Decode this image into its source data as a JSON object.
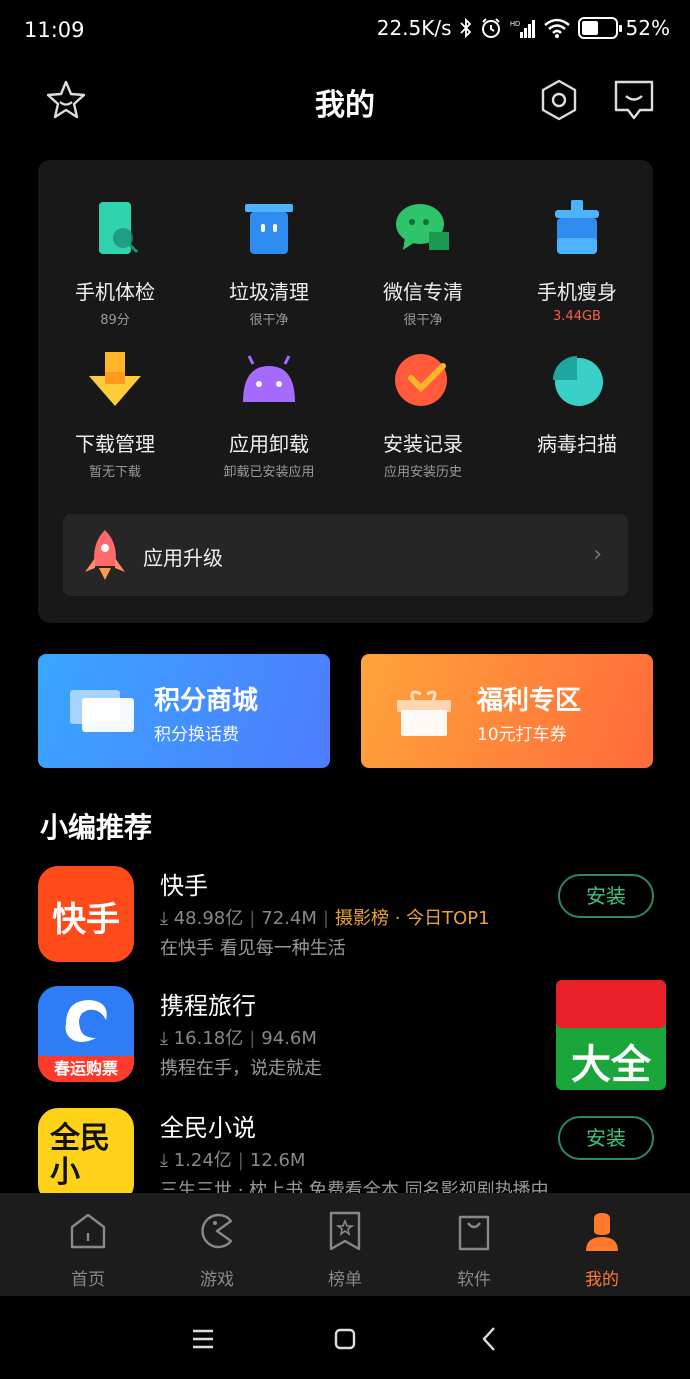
{
  "status_bar": {
    "time": "11:09",
    "speed": "22.5K/s",
    "battery": "52%",
    "battery_level": 0.52
  },
  "header": {
    "title": "我的"
  },
  "tools": [
    {
      "label": "手机体检",
      "sub": "89分"
    },
    {
      "label": "垃圾清理",
      "sub": "很干净"
    },
    {
      "label": "微信专清",
      "sub": "很干净"
    },
    {
      "label": "手机瘦身",
      "sub": "3.44GB"
    },
    {
      "label": "下载管理",
      "sub": "暂无下载"
    },
    {
      "label": "应用卸载",
      "sub": "卸载已安装应用"
    },
    {
      "label": "安装记录",
      "sub": "应用安装历史"
    },
    {
      "label": "病毒扫描",
      "sub": ""
    }
  ],
  "upgrade": {
    "label": "应用升级"
  },
  "promos": {
    "points": {
      "title": "积分商城",
      "sub": "积分换话费"
    },
    "welfare": {
      "title": "福利专区",
      "sub": "10元打车券"
    }
  },
  "recommend": {
    "title": "小编推荐",
    "apps": [
      {
        "name": "快手",
        "downloads": "48.98亿",
        "size": "72.4M",
        "tag": "摄影榜 · 今日TOP1",
        "desc": "在快手 看见每一种生活",
        "icon_text": "快手",
        "action": "安装"
      },
      {
        "name": "携程旅行",
        "downloads": "16.18亿",
        "size": "94.6M",
        "tag": "",
        "desc": "携程在手，说走就走",
        "icon_text": "春运购票",
        "ad_text": "大全"
      },
      {
        "name": "全民小说",
        "downloads": "1.24亿",
        "size": "12.6M",
        "tag": "",
        "desc": "三生三世 · 枕上书 免费看全本 同名影视剧热播中",
        "icon_text": "全民小",
        "action": "安装"
      }
    ]
  },
  "bottom_nav": [
    {
      "label": "首页",
      "icon": "home-icon"
    },
    {
      "label": "游戏",
      "icon": "game-icon"
    },
    {
      "label": "榜单",
      "icon": "ranking-icon"
    },
    {
      "label": "软件",
      "icon": "software-icon"
    },
    {
      "label": "我的",
      "icon": "profile-icon",
      "active": true
    }
  ],
  "colors": {
    "accent_orange": "#ff7a2a",
    "install_green": "#3cc47f",
    "card_bg": "#181818"
  }
}
